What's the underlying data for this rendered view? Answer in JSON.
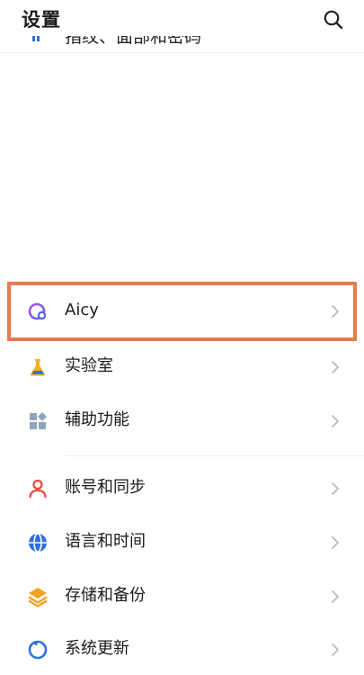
{
  "header": {
    "title": "设置"
  },
  "partial_item": {
    "label": "指纹、面部和密码"
  },
  "groups": [
    {
      "items": [
        {
          "label": "Aicy",
          "highlighted": true,
          "icon": "aicy-icon",
          "color": "#7b5cf0"
        },
        {
          "label": "实验室",
          "icon": "flask-icon",
          "color": "#f2b318"
        },
        {
          "label": "辅助功能",
          "icon": "accessibility-grid-icon",
          "color": "#8fa4b8"
        }
      ]
    },
    {
      "items": [
        {
          "label": "账号和同步",
          "icon": "user-icon",
          "color": "#e84c3d"
        },
        {
          "label": "语言和时间",
          "icon": "globe-icon",
          "color": "#2d6fdc"
        },
        {
          "label": "存储和备份",
          "icon": "layers-icon",
          "color": "#f2a21b"
        },
        {
          "label": "系统更新",
          "icon": "refresh-icon",
          "color": "#2d6fdc"
        }
      ]
    }
  ],
  "colors": {
    "highlight_border": "#e87a4e",
    "chevron": "#b9b9b9"
  }
}
